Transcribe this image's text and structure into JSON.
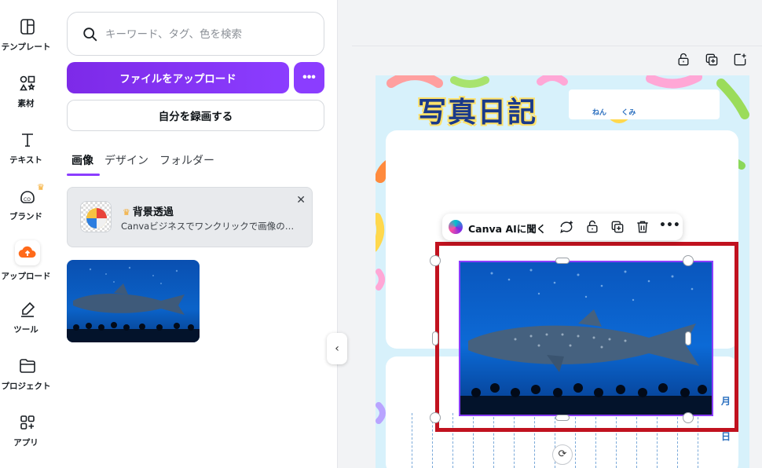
{
  "sidebar": {
    "items": [
      {
        "label": "テンプレート",
        "icon": "template-icon"
      },
      {
        "label": "素材",
        "icon": "elements-icon"
      },
      {
        "label": "テキスト",
        "icon": "text-icon"
      },
      {
        "label": "ブランド",
        "icon": "brand-icon"
      },
      {
        "label": "アップロード",
        "icon": "upload-icon"
      },
      {
        "label": "ツール",
        "icon": "tools-icon"
      },
      {
        "label": "プロジェクト",
        "icon": "folder-icon"
      },
      {
        "label": "アプリ",
        "icon": "apps-icon"
      }
    ],
    "active_index": 4
  },
  "panel": {
    "search_placeholder": "キーワード、タグ、色を検索",
    "upload_label": "ファイルをアップロード",
    "more_label": "•••",
    "record_label": "自分を録画する",
    "tabs": [
      {
        "label": "画像"
      },
      {
        "label": "デザイン"
      },
      {
        "label": "フォルダー"
      }
    ],
    "active_tab": 0,
    "promo": {
      "title": "背景透過",
      "description": "Canvaビジネスでワンクリックで画像の…"
    }
  },
  "toolbar": {
    "ai_label": "Canva AIに聞く",
    "more_label": "•••"
  },
  "design": {
    "title": "写真日記",
    "year_label": "ねん",
    "class_label": "くみ",
    "month_label": "月",
    "day_label": "日"
  },
  "colors": {
    "accent": "#8b3dff",
    "selection": "#c1121f",
    "title_text": "#1a3a8a",
    "page_bg": "#d7f1fb"
  }
}
